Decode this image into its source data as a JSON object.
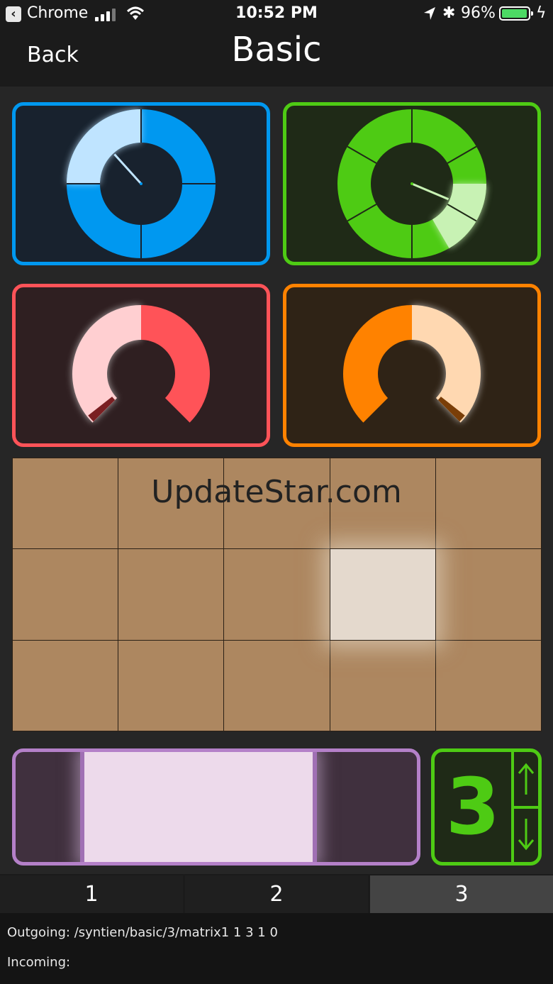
{
  "status_bar": {
    "carrier": "Chrome",
    "time": "10:52 PM",
    "battery": "96%",
    "battery_level": 0.96
  },
  "nav": {
    "back_label": "Back",
    "title": "Basic"
  },
  "knobs": [
    {
      "name": "knob-blue",
      "color": "#0098f0",
      "light": "#bfe4ff",
      "bg": "#18222e",
      "type": "full-circle",
      "segments": 4,
      "value": 0.12
    },
    {
      "name": "knob-green",
      "color": "#4ecb14",
      "light": "#c8f2b4",
      "bg": "#1f2a17",
      "type": "full-circle",
      "segments": 6,
      "value": 0.33
    },
    {
      "name": "knob-red",
      "color": "#ff5358",
      "light": "#ffcfd1",
      "bg": "#2f1f21",
      "type": "arc",
      "mode": "left-fill",
      "value": 0.5
    },
    {
      "name": "knob-orange",
      "color": "#ff8200",
      "light": "#ffd8b1",
      "bg": "#2f2316",
      "type": "arc",
      "mode": "right-fill",
      "value": 0.5
    }
  ],
  "matrix": {
    "columns": 5,
    "rows": 3,
    "active": [
      {
        "row": 1,
        "col": 3
      }
    ],
    "color": "#ad8760",
    "active_color": "#e4d9cd"
  },
  "watermark": "UpdateStar.com",
  "fader": {
    "range_start": 0.16,
    "range_end": 0.73,
    "color": "#b480c8"
  },
  "stepper": {
    "value": "3",
    "color": "#4ecb14"
  },
  "tabs": [
    {
      "label": "1",
      "active": false
    },
    {
      "label": "2",
      "active": false
    },
    {
      "label": "3",
      "active": true
    }
  ],
  "log": {
    "outgoing": "Outgoing: /syntien/basic/3/matrix1 1 3 1 0",
    "incoming": "Incoming:"
  }
}
